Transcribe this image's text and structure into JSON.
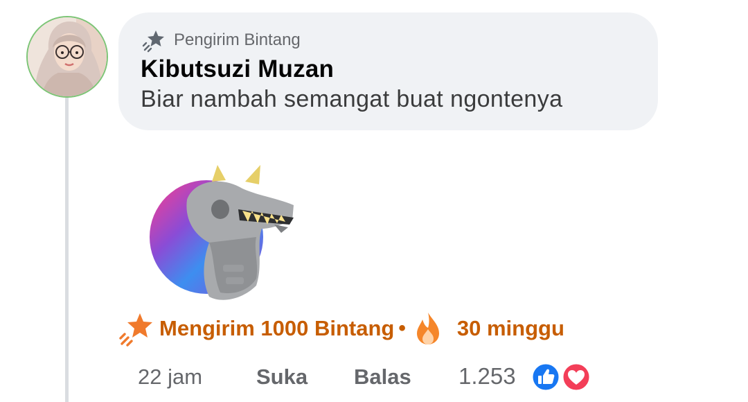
{
  "comment": {
    "badge_label": "Pengirim Bintang",
    "author": "Kibutsuzi Muzan",
    "text": "Biar nambah semangat buat ngontenya"
  },
  "stars": {
    "sent_label": "Mengirim 1000 Bintang",
    "separator": "•",
    "streak_label": "30 minggu"
  },
  "actions": {
    "time": "22 jam",
    "like_label": "Suka",
    "reply_label": "Balas",
    "reaction_count": "1.253"
  },
  "icons": {
    "badge": "stars-sender-icon",
    "stars": "stars-icon",
    "streak": "flame-icon",
    "reactions": [
      "like-reaction-icon",
      "love-reaction-icon"
    ]
  },
  "colors": {
    "bubble_bg": "#f0f2f5",
    "stars_accent": "#c75d00",
    "secondary_text": "#65676b",
    "like_blue": "#1877f2",
    "love_red": "#f33e58"
  }
}
